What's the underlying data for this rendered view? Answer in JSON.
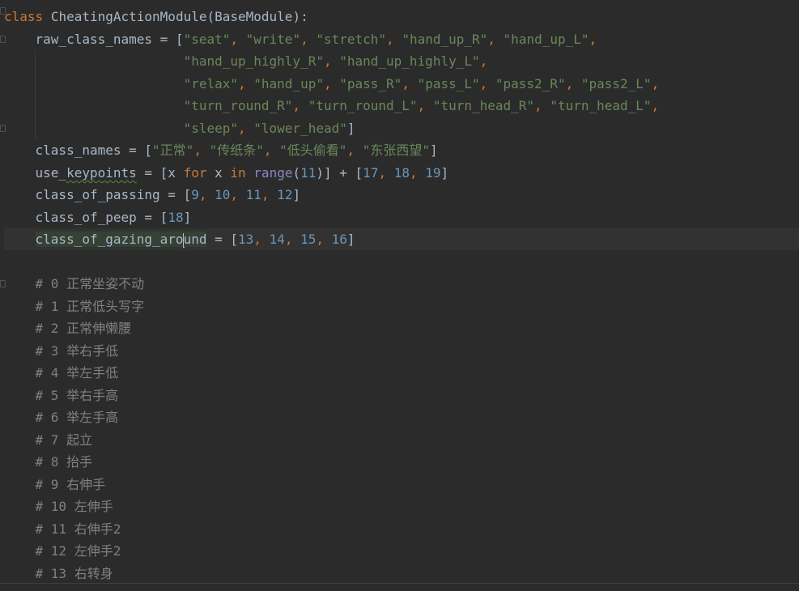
{
  "editor": {
    "language": "python",
    "class_decl": {
      "keyword": "class",
      "name": "CheatingActionModule",
      "open": "(",
      "base": "BaseModule",
      "close": "):"
    },
    "raw_class_names": {
      "name": "raw_class_names",
      "assign": " = ",
      "items": [
        "\"seat\"",
        "\"write\"",
        "\"stretch\"",
        "\"hand_up_R\"",
        "\"hand_up_L\"",
        "\"hand_up_highly_R\"",
        "\"hand_up_highly_L\"",
        "\"relax\"",
        "\"hand_up\"",
        "\"pass_R\"",
        "\"pass_L\"",
        "\"pass2_R\"",
        "\"pass2_L\"",
        "\"turn_round_R\"",
        "\"turn_round_L\"",
        "\"turn_head_R\"",
        "\"turn_head_L\"",
        "\"sleep\"",
        "\"lower_head\""
      ]
    },
    "class_names": {
      "name": "class_names",
      "assign": " = ",
      "items": [
        "\"正常\"",
        "\"传纸条\"",
        "\"低头偷看\"",
        "\"东张西望\""
      ]
    },
    "use_keypoints": {
      "name": "use_",
      "name_typo": "keypoints",
      "assign": " = ",
      "open": "[",
      "var": "x ",
      "for_kw": "for",
      "var2": " x ",
      "in_kw": "in",
      "range_fn": "range",
      "range_arg": "11",
      "middle": ")] + [",
      "items": [
        "17",
        "18",
        "19"
      ],
      "close": "]"
    },
    "class_of_passing": {
      "name": "class_of_passing",
      "assign": " = ",
      "items": [
        "9",
        "10",
        "11",
        "12"
      ]
    },
    "class_of_peep": {
      "name": "class_of_peep",
      "assign": " = ",
      "items": [
        "18"
      ]
    },
    "class_of_gazing_around": {
      "name_before_caret": "class_of_gazing_aro",
      "name_after_caret": "und",
      "assign": " = ",
      "items": [
        "13",
        "14",
        "15",
        "16"
      ]
    },
    "comments": [
      "# 0 正常坐姿不动",
      "# 1 正常低头写字",
      "# 2 正常伸懒腰",
      "# 3 举右手低",
      "# 4 举左手低",
      "# 5 举右手高",
      "# 6 举左手高",
      "# 7 起立",
      "# 8 抬手",
      "# 9 右伸手",
      "# 10 左伸手",
      "# 11 右伸手2",
      "# 12 左伸手2",
      "# 13 右转身"
    ],
    "punct": {
      "open_bracket": "[",
      "close_bracket": "]",
      "sep": ", ",
      "sep_trail": ","
    },
    "colors": {
      "background": "#2b2b2b",
      "keyword": "#cc7832",
      "string": "#6a8759",
      "number": "#6897bb",
      "comment": "#808080",
      "identifier": "#a9b7c6",
      "builtin": "#8888c6",
      "current_line": "#323232"
    }
  }
}
